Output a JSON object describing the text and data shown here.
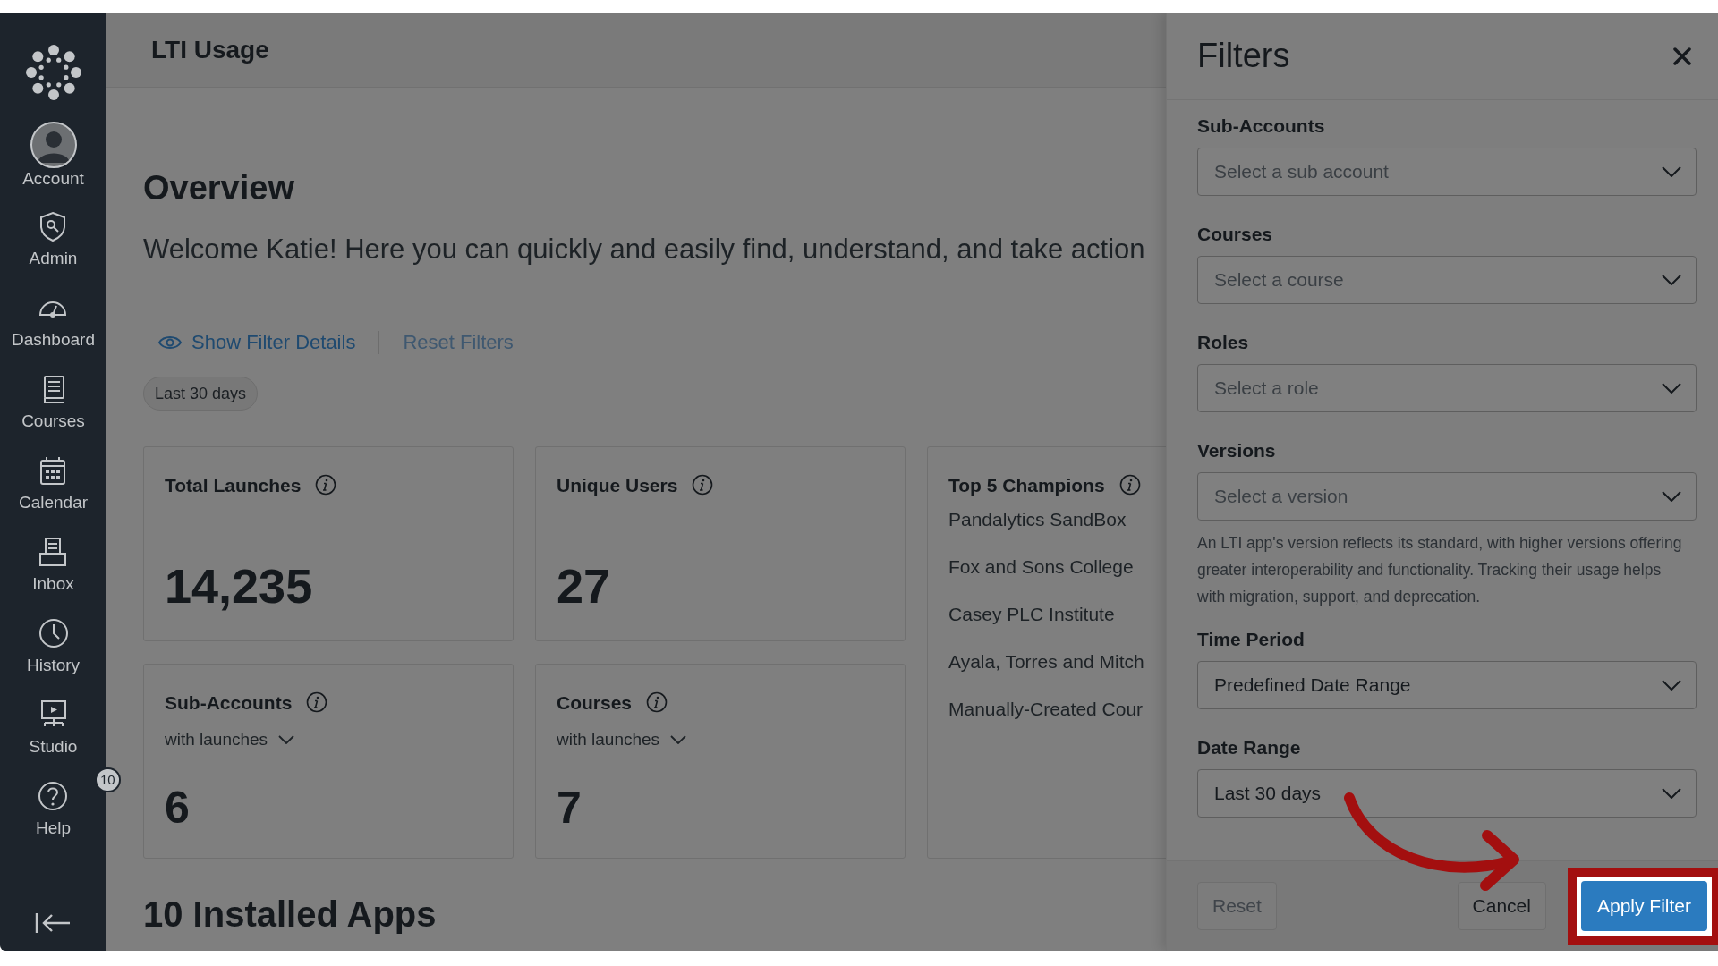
{
  "sidebar": {
    "items": [
      {
        "label": "Account",
        "kind": "avatar"
      },
      {
        "label": "Admin",
        "kind": "icon"
      },
      {
        "label": "Dashboard",
        "kind": "icon"
      },
      {
        "label": "Courses",
        "kind": "icon"
      },
      {
        "label": "Calendar",
        "kind": "icon"
      },
      {
        "label": "Inbox",
        "kind": "icon"
      },
      {
        "label": "History",
        "kind": "icon"
      },
      {
        "label": "Studio",
        "kind": "icon"
      },
      {
        "label": "Help",
        "kind": "icon",
        "badge": "10"
      }
    ]
  },
  "header": {
    "title": "LTI Usage"
  },
  "overview": {
    "title": "Overview",
    "welcome": "Welcome Katie! Here you can quickly and easily find, understand, and take action",
    "show_filter_details": "Show Filter Details",
    "reset_filters": "Reset Filters",
    "chip": "Last 30 days"
  },
  "cards": [
    {
      "kind": "stat",
      "title": "Total Launches",
      "value": "14,235"
    },
    {
      "kind": "stat",
      "title": "Unique Users",
      "value": "27"
    },
    {
      "kind": "list",
      "title": "Top 5 Champions",
      "items": [
        "Pandalytics SandBox",
        "Fox and Sons College",
        "Casey PLC Institute",
        "Ayala, Torres and Mitch",
        "Manually-Created Cour"
      ]
    },
    {
      "kind": "stat",
      "title": "Sub-Accounts",
      "subtitle": "with launches",
      "value": "6"
    },
    {
      "kind": "stat",
      "title": "Courses",
      "subtitle": "with launches",
      "value": "7"
    }
  ],
  "installed_apps_title": "10 Installed Apps",
  "filters": {
    "title": "Filters",
    "fields": [
      {
        "label": "Sub-Accounts",
        "placeholder": "Select a sub account"
      },
      {
        "label": "Courses",
        "placeholder": "Select a course"
      },
      {
        "label": "Roles",
        "placeholder": "Select a role"
      },
      {
        "label": "Versions",
        "placeholder": "Select a version",
        "help": "An LTI app's version reflects its standard, with higher versions offering greater interoperability and functionality. Tracking their usage helps with migration, support, and deprecation."
      },
      {
        "label": "Time Period",
        "value": "Predefined Date Range"
      },
      {
        "label": "Date Range",
        "value": "Last 30 days"
      }
    ],
    "buttons": [
      {
        "kind": "secondary",
        "label": "Reset",
        "disabled": true,
        "highlighted": false
      },
      {
        "kind": "secondary",
        "label": "Cancel",
        "disabled": false,
        "highlighted": false
      },
      {
        "kind": "primary",
        "label": "Apply Filter",
        "disabled": false,
        "highlighted": true
      }
    ]
  }
}
